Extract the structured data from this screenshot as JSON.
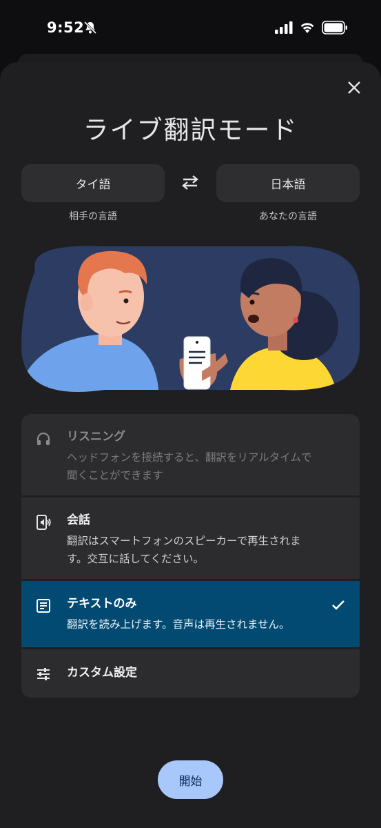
{
  "status_bar": {
    "time": "9:52",
    "icons": [
      "bell-off-icon",
      "signal-icon",
      "wifi-icon",
      "battery-icon"
    ]
  },
  "sheet": {
    "title": "ライブ翻訳モード",
    "close_icon": "close-icon"
  },
  "languages": {
    "source": {
      "label": "タイ語",
      "caption": "相手の言語"
    },
    "target": {
      "label": "日本語",
      "caption": "あなたの言語"
    },
    "swap_icon": "swap-icon"
  },
  "illustration": {
    "icon": "two-people-conversation-illustration",
    "colors": {
      "background": "#2c3c63",
      "left_shirt": "#6ea3ec",
      "right_shirt": "#fdd835",
      "hair_left": "#e5774e"
    }
  },
  "options": [
    {
      "title": "リスニング",
      "desc": "ヘッドフォンを接続すると、翻訳をリアルタイムで聞くことができます",
      "icon": "headphones-icon",
      "state": "disabled"
    },
    {
      "title": "会話",
      "desc": "翻訳はスマートフォンのスピーカーで再生されます。交互に話してください。",
      "icon": "phone-speaker-icon",
      "state": "normal"
    },
    {
      "title": "テキストのみ",
      "desc": "翻訳を読み上げます。音声は再生されません。",
      "icon": "text-document-icon",
      "state": "selected"
    },
    {
      "title": "カスタム設定",
      "desc": "",
      "icon": "sliders-icon",
      "state": "normal"
    }
  ],
  "start_button": {
    "label": "開始"
  },
  "colors": {
    "selected": "#034a72",
    "accent_button": "#a8c7fa",
    "sheet_bg": "#1f1f21"
  }
}
